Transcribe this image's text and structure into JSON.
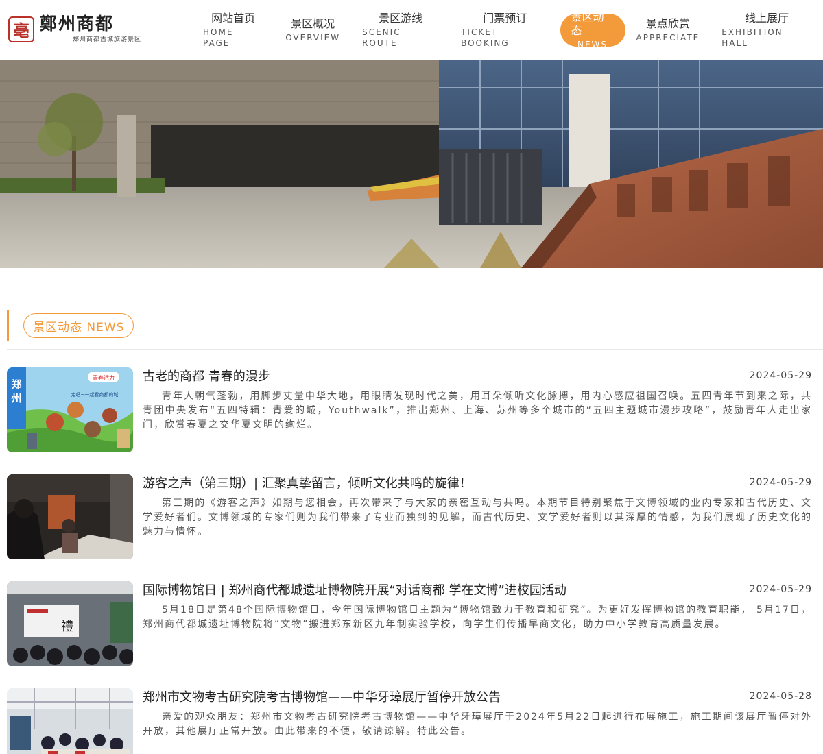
{
  "logo": {
    "seal_glyph": "亳",
    "title": "鄭州商都",
    "subtitle": "郑州商都古城旅游景区"
  },
  "nav": [
    {
      "zh": "网站首页",
      "en": "HOME PAGE"
    },
    {
      "zh": "景区概况",
      "en": "OVERVIEW"
    },
    {
      "zh": "景区游线",
      "en": "SCENIC ROUTE"
    },
    {
      "zh": "门票预订",
      "en": "TICKET BOOKING"
    },
    {
      "zh": "景区动态",
      "en": "NEWS"
    },
    {
      "zh": "景点欣赏",
      "en": "APPRECIATE"
    },
    {
      "zh": "线上展厅",
      "en": "EXHIBITION HALL"
    }
  ],
  "active_nav": "NEWS",
  "section": {
    "title": "景区动态 NEWS"
  },
  "news": [
    {
      "title": "古老的商都 青春的漫步",
      "date": "2024-05-29",
      "body": "青年人朝气蓬勃，用脚步丈量中华大地，用眼睛发现时代之美，用耳朵倾听文化脉搏，用内心感应祖国召唤。五四青年节到来之际，共青团中央发布“五四特辑：青爱的城，Youthwalk”，推出郑州、上海、苏州等多个城市的“五四主题城市漫步攻略”，鼓励青年人走出家门，欣赏春夏之交华夏文明的绚烂。"
    },
    {
      "title": "游客之声（第三期）| 汇聚真挚留言，倾听文化共鸣的旋律！",
      "date": "2024-05-29",
      "body": "第三期的《游客之声》如期与您相会，再次带来了与大家的亲密互动与共鸣。本期节目特别聚焦于文博领域的业内专家和古代历史、文学爱好者们。文博领域的专家们则为我们带来了专业而独到的见解，而古代历史、文学爱好者则以其深厚的情感，为我们展现了历史文化的魅力与情怀。"
    },
    {
      "title": "国际博物馆日 | 郑州商代都城遗址博物院开展“对话商都 学在文博”进校园活动",
      "date": "2024-05-29",
      "body": "5月18日是第48个国际博物馆日，今年国际博物馆日主题为“博物馆致力于教育和研究”。为更好发挥博物馆的教育职能， 5月17日，郑州商代都城遗址博物院将“文物”搬进郑东新区九年制实验学校，向学生们传播早商文化，助力中小学教育高质量发展。"
    },
    {
      "title": "郑州市文物考古研究院考古博物馆——中华牙璋展厅暂停开放公告",
      "date": "2024-05-28",
      "body": "亲爱的观众朋友：郑州市文物考古研究院考古博物馆——中华牙璋展厅于2024年5月22日起进行布展施工，施工期间该展厅暂停对外开放，其他展厅正常开放。由此带来的不便，敬请谅解。特此公告。"
    }
  ],
  "thumb1": {
    "side_text": "郑州",
    "badge": "青春活力",
    "caption": "走吧~一起看商都的城"
  },
  "thumb3": {
    "screen_glyph": "禮"
  },
  "colors": {
    "accent": "#f39a3a",
    "seal": "#b8322a"
  }
}
